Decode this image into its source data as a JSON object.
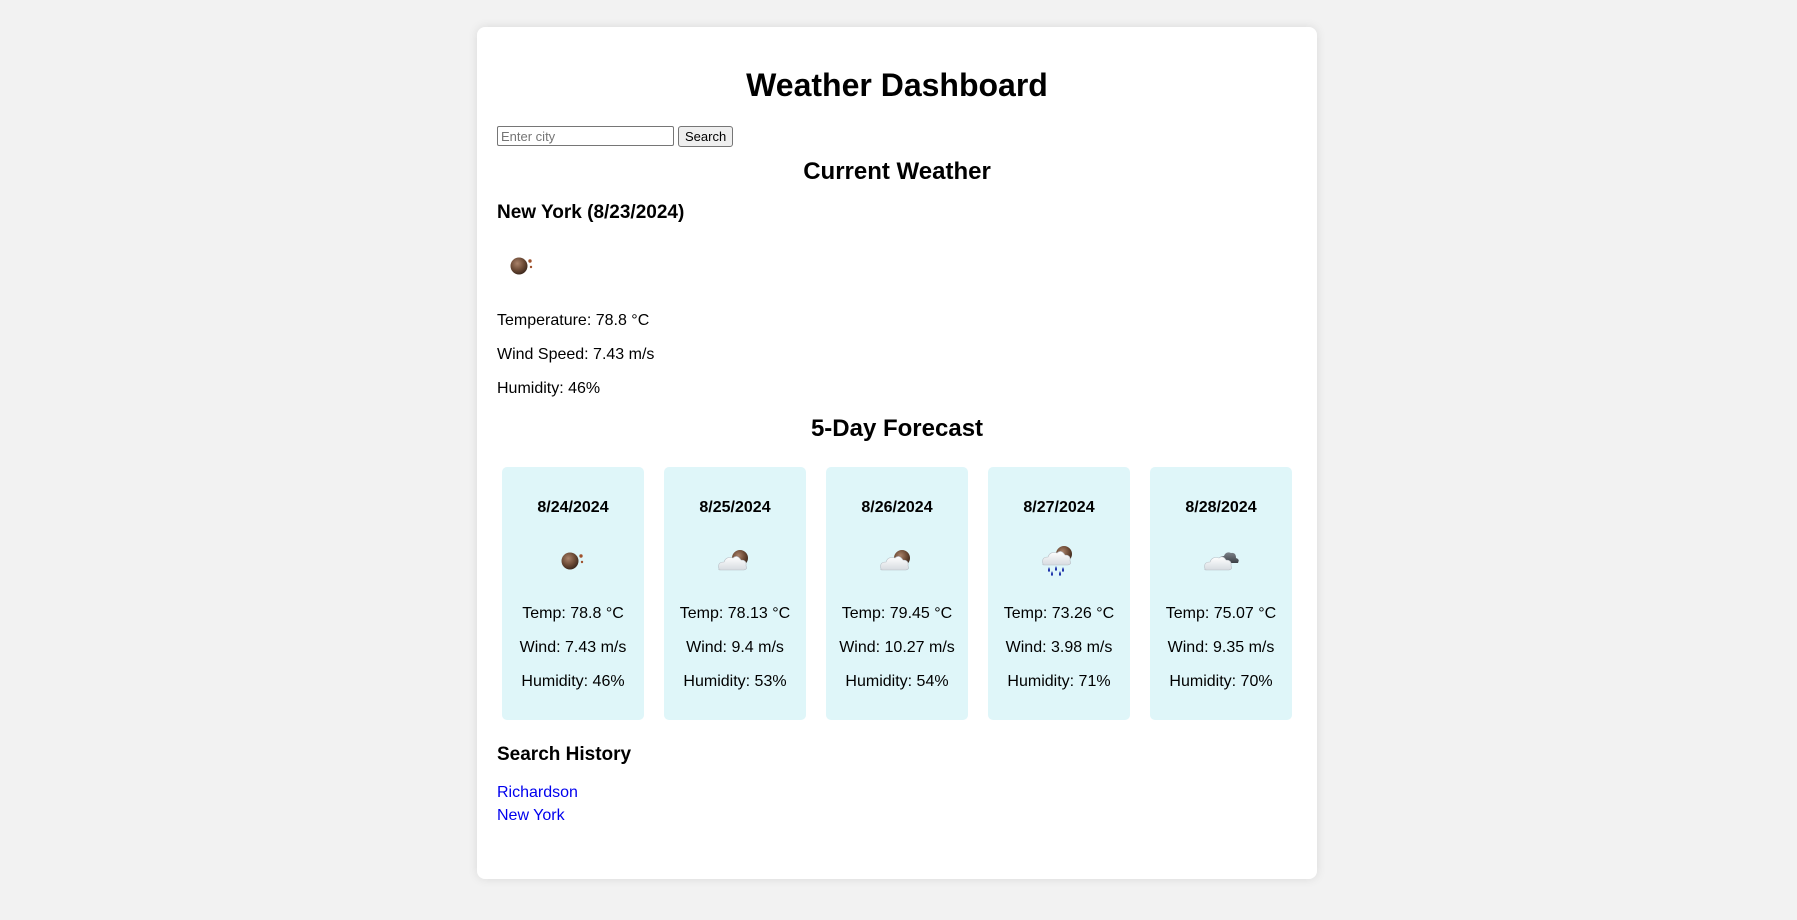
{
  "header": {
    "title": "Weather Dashboard"
  },
  "search": {
    "placeholder": "Enter city",
    "value": "",
    "button_label": "Search"
  },
  "current": {
    "section_title": "Current Weather",
    "city_heading": "New York (8/23/2024)",
    "icon": "overcast-night-icon",
    "temperature": "Temperature: 78.8 °C",
    "wind": "Wind Speed: 7.43 m/s",
    "humidity": "Humidity: 46%"
  },
  "forecast": {
    "section_title": "5-Day Forecast",
    "days": [
      {
        "date": "8/24/2024",
        "icon": "overcast-night-icon",
        "temp": "Temp: 78.8 °C",
        "wind": "Wind: 7.43 m/s",
        "humidity": "Humidity: 46%"
      },
      {
        "date": "8/25/2024",
        "icon": "cloudy-night-icon",
        "temp": "Temp: 78.13 °C",
        "wind": "Wind: 9.4 m/s",
        "humidity": "Humidity: 53%"
      },
      {
        "date": "8/26/2024",
        "icon": "cloudy-night-icon",
        "temp": "Temp: 79.45 °C",
        "wind": "Wind: 10.27 m/s",
        "humidity": "Humidity: 54%"
      },
      {
        "date": "8/27/2024",
        "icon": "rain-night-icon",
        "temp": "Temp: 73.26 °C",
        "wind": "Wind: 3.98 m/s",
        "humidity": "Humidity: 71%"
      },
      {
        "date": "8/28/2024",
        "icon": "broken-clouds-icon",
        "temp": "Temp: 75.07 °C",
        "wind": "Wind: 9.35 m/s",
        "humidity": "Humidity: 70%"
      }
    ]
  },
  "history": {
    "title": "Search History",
    "items": [
      "Richardson",
      "New York"
    ]
  },
  "colors": {
    "page_background": "#f2f2f2",
    "card_background": "#dff6f9",
    "link": "#0000ee"
  }
}
